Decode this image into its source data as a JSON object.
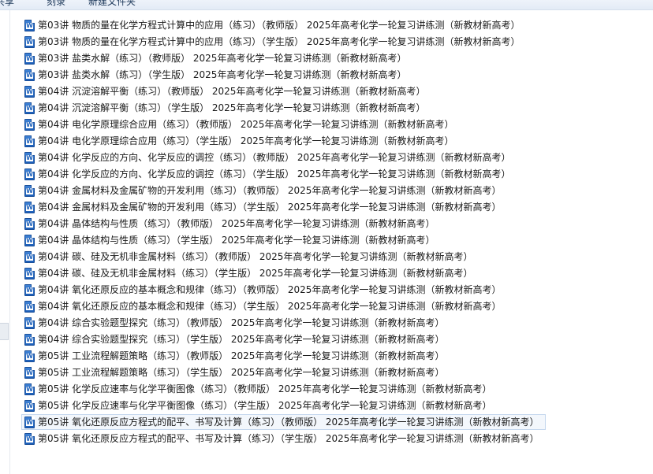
{
  "toolbar": {
    "item_left": "共享",
    "item_burn": "刻录",
    "item_new_folder": "新建文件夹"
  },
  "files": [
    "第03讲 物质的量在化学方程式计算中的应用（练习）（教师版） 2025年高考化学一轮复习讲练测（新教材新高考）",
    "第03讲 物质的量在化学方程式计算中的应用（练习）（学生版） 2025年高考化学一轮复习讲练测（新教材新高考）",
    "第03讲 盐类水解（练习）（教师版） 2025年高考化学一轮复习讲练测（新教材新高考）",
    "第03讲 盐类水解（练习）（学生版） 2025年高考化学一轮复习讲练测（新教材新高考）",
    "第04讲 沉淀溶解平衡（练习）（教师版） 2025年高考化学一轮复习讲练测（新教材新高考）",
    "第04讲 沉淀溶解平衡（练习）（学生版） 2025年高考化学一轮复习讲练测（新教材新高考）",
    "第04讲 电化学原理综合应用（练习）（教师版） 2025年高考化学一轮复习讲练测（新教材新高考）",
    "第04讲 电化学原理综合应用（练习）（学生版） 2025年高考化学一轮复习讲练测（新教材新高考）",
    "第04讲 化学反应的方向、化学反应的调控（练习）（教师版） 2025年高考化学一轮复习讲练测（新教材新高考）",
    "第04讲 化学反应的方向、化学反应的调控（练习）（学生版） 2025年高考化学一轮复习讲练测（新教材新高考）",
    "第04讲 金属材料及金属矿物的开发利用（练习）（教师版） 2025年高考化学一轮复习讲练测（新教材新高考）",
    "第04讲 金属材料及金属矿物的开发利用（练习）（学生版） 2025年高考化学一轮复习讲练测（新教材新高考）",
    "第04讲 晶体结构与性质（练习）（教师版） 2025年高考化学一轮复习讲练测（新教材新高考）",
    "第04讲 晶体结构与性质（练习）（学生版） 2025年高考化学一轮复习讲练测（新教材新高考）",
    "第04讲 碳、硅及无机非金属材料（练习）（教师版） 2025年高考化学一轮复习讲练测（新教材新高考）",
    "第04讲 碳、硅及无机非金属材料（练习）（学生版） 2025年高考化学一轮复习讲练测（新教材新高考）",
    "第04讲 氧化还原反应的基本概念和规律（练习）（教师版） 2025年高考化学一轮复习讲练测（新教材新高考）",
    "第04讲 氧化还原反应的基本概念和规律（练习）（学生版） 2025年高考化学一轮复习讲练测（新教材新高考）",
    "第04讲 综合实验题型探究（练习）（教师版） 2025年高考化学一轮复习讲练测（新教材新高考）",
    "第04讲 综合实验题型探究（练习）（学生版） 2025年高考化学一轮复习讲练测（新教材新高考）",
    "第05讲 工业流程解题策略（练习）（教师版） 2025年高考化学一轮复习讲练测（新教材新高考）",
    "第05讲 工业流程解题策略（练习）（学生版） 2025年高考化学一轮复习讲练测（新教材新高考）",
    "第05讲 化学反应速率与化学平衡图像（练习）（教师版） 2025年高考化学一轮复习讲练测（新教材新高考）",
    "第05讲 化学反应速率与化学平衡图像（练习）（学生版） 2025年高考化学一轮复习讲练测（新教材新高考）",
    "第05讲 氧化还原反应方程式的配平、书写及计算（练习）（教师版） 2025年高考化学一轮复习讲练测（新教材新高考）",
    "第05讲 氧化还原反应方程式的配平、书写及计算（练习）（学生版） 2025年高考化学一轮复习讲练测（新教材新高考）"
  ],
  "selected_index": 24,
  "icon": "word-doc-icon",
  "colors": {
    "icon_blue": "#1c5fb8",
    "selection_border": "#c5d7ee",
    "selection_fill": "#f3f7fc",
    "toolbar_text": "#1e395b"
  }
}
